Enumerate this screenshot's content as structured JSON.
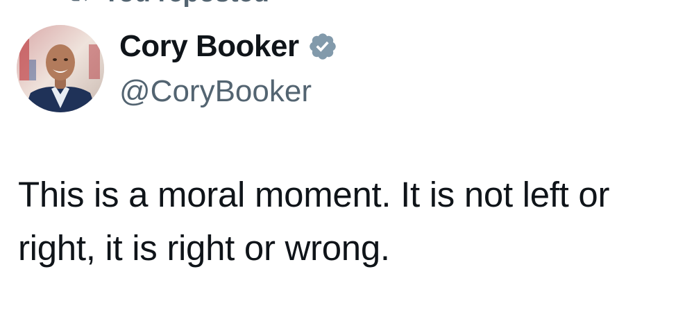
{
  "repost": {
    "icon": "repost-icon",
    "label": "You reposted"
  },
  "tweet": {
    "author": {
      "avatar": "avatar",
      "display_name": "Cory Booker",
      "verified_icon": "verified-badge-icon",
      "handle": "@CoryBooker"
    },
    "text": "This is a moral moment. It is not left or right, it is right or wrong."
  },
  "colors": {
    "text_primary": "#0f1419",
    "text_secondary": "#536471",
    "verified_badge": "#829aab",
    "background": "#ffffff"
  }
}
